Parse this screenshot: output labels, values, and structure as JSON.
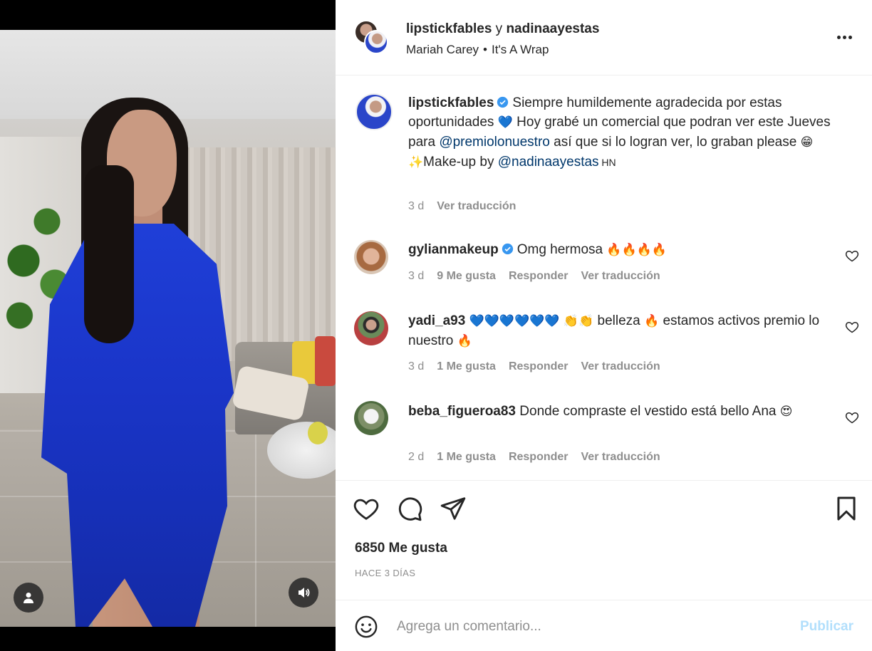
{
  "post": {
    "users": {
      "first": "lipstickfables",
      "connector": " y ",
      "second": "nadinaayestas"
    },
    "audio": {
      "artist": "Mariah Carey",
      "separator": "•",
      "track": "It's A Wrap"
    },
    "menu_icon": "more-horizontal-icon"
  },
  "caption": {
    "username": "lipstickfables",
    "text_1": "Siempre humildemente agradecida por estas oportunidades",
    "emoji_1": "💙",
    "text_2": " Hoy grabé un comercial que podran ver este Jueves para ",
    "mention_1": "@premiolonuestro",
    "text_3": " así que si lo logran ver, lo graban please ",
    "emoji_2": "😁",
    "emoji_3": "✨",
    "text_4": "Make-up by ",
    "mention_2": "@nadinaayestas",
    "text_5": " HN",
    "time": "3 d",
    "translate": "Ver traducción"
  },
  "comments": [
    {
      "username": "gylianmakeup",
      "verified": true,
      "text": "Omg hermosa ",
      "emoji": "🔥🔥🔥🔥",
      "time": "3 d",
      "likes": "9 Me gusta",
      "reply": "Responder",
      "translate": "Ver traducción"
    },
    {
      "username": "yadi_a93",
      "verified": false,
      "emoji_a": "💙💙💙💙💙💙",
      "emoji_b": "👏👏",
      "text_a": " belleza ",
      "emoji_c": "🔥",
      "text_b": " estamos activos premio lo nuestro ",
      "emoji_d": "🔥",
      "time": "3 d",
      "likes": "1 Me gusta",
      "reply": "Responder",
      "translate": "Ver traducción"
    },
    {
      "username": "beba_figueroa83",
      "verified": false,
      "text": "Donde compraste el vestido está bello Ana",
      "emoji": "😍",
      "time": "2 d",
      "likes": "1 Me gusta",
      "reply": "Responder",
      "translate": "Ver traducción"
    }
  ],
  "actions": {
    "icons": [
      "heart-icon",
      "comment-icon",
      "share-icon",
      "bookmark-icon"
    ],
    "likes": "6850 Me gusta",
    "posted": "HACE 3 DÍAS"
  },
  "composer": {
    "placeholder": "Agrega un comentario...",
    "publish_label": "Publicar"
  },
  "colors": {
    "text": "#262626",
    "secondary": "#8e8e8e",
    "mention": "#00376b",
    "verified": "#3897f0",
    "publish_disabled": "#b2dffc"
  }
}
